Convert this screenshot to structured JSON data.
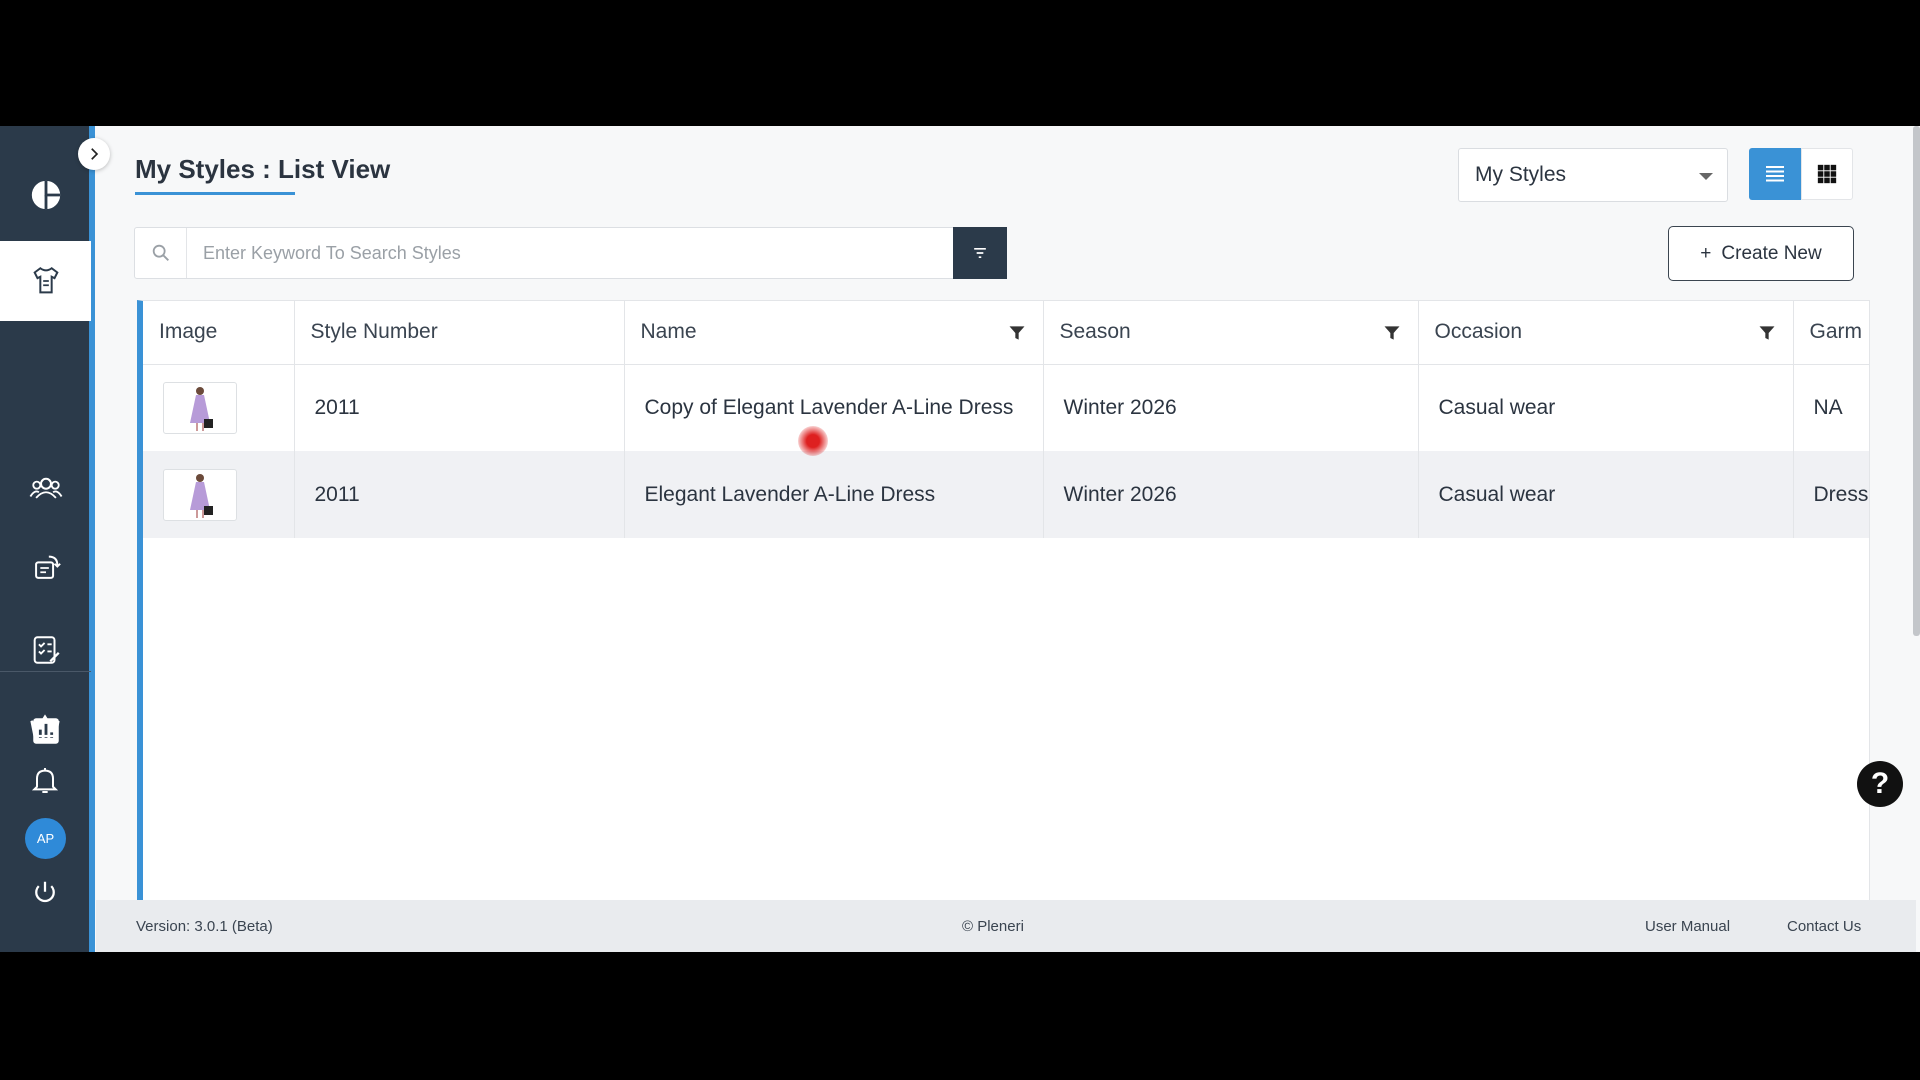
{
  "page": {
    "title": "My Styles : List View"
  },
  "sidebar": {
    "items": [
      {
        "icon": "pie-chart-icon"
      },
      {
        "icon": "styles-shirt-icon",
        "active": true
      },
      {
        "icon": "users-icon"
      },
      {
        "icon": "workflow-icon"
      },
      {
        "icon": "checklist-icon"
      },
      {
        "icon": "bar-chart-icon"
      }
    ],
    "bottom": [
      {
        "icon": "crown-icon"
      },
      {
        "icon": "bell-icon"
      },
      {
        "icon": "power-icon"
      }
    ],
    "avatar_initials": "AP"
  },
  "header": {
    "view_select_value": "My Styles",
    "search_placeholder": "Enter Keyword To Search Styles",
    "create_label": "Create New",
    "create_plus": "+"
  },
  "table": {
    "columns": [
      "Image",
      "Style Number",
      "Name",
      "Season",
      "Occasion",
      "Garm"
    ],
    "filterable": [
      false,
      false,
      true,
      true,
      true,
      false
    ],
    "rows": [
      {
        "style_number": "2011",
        "name": "Copy of Elegant Lavender A-Line Dress",
        "season": "Winter 2026",
        "occasion": "Casual wear",
        "garment": "NA"
      },
      {
        "style_number": "2011",
        "name": "Elegant Lavender A-Line Dress",
        "season": "Winter 2026",
        "occasion": "Casual wear",
        "garment": "Dress"
      }
    ]
  },
  "footer": {
    "version": "Version: 3.0.1 (Beta)",
    "copyright": "© Pleneri",
    "user_manual": "User Manual",
    "contact": "Contact Us"
  },
  "colors": {
    "accent": "#3a92d6",
    "sidebar": "#2b3a4a"
  }
}
